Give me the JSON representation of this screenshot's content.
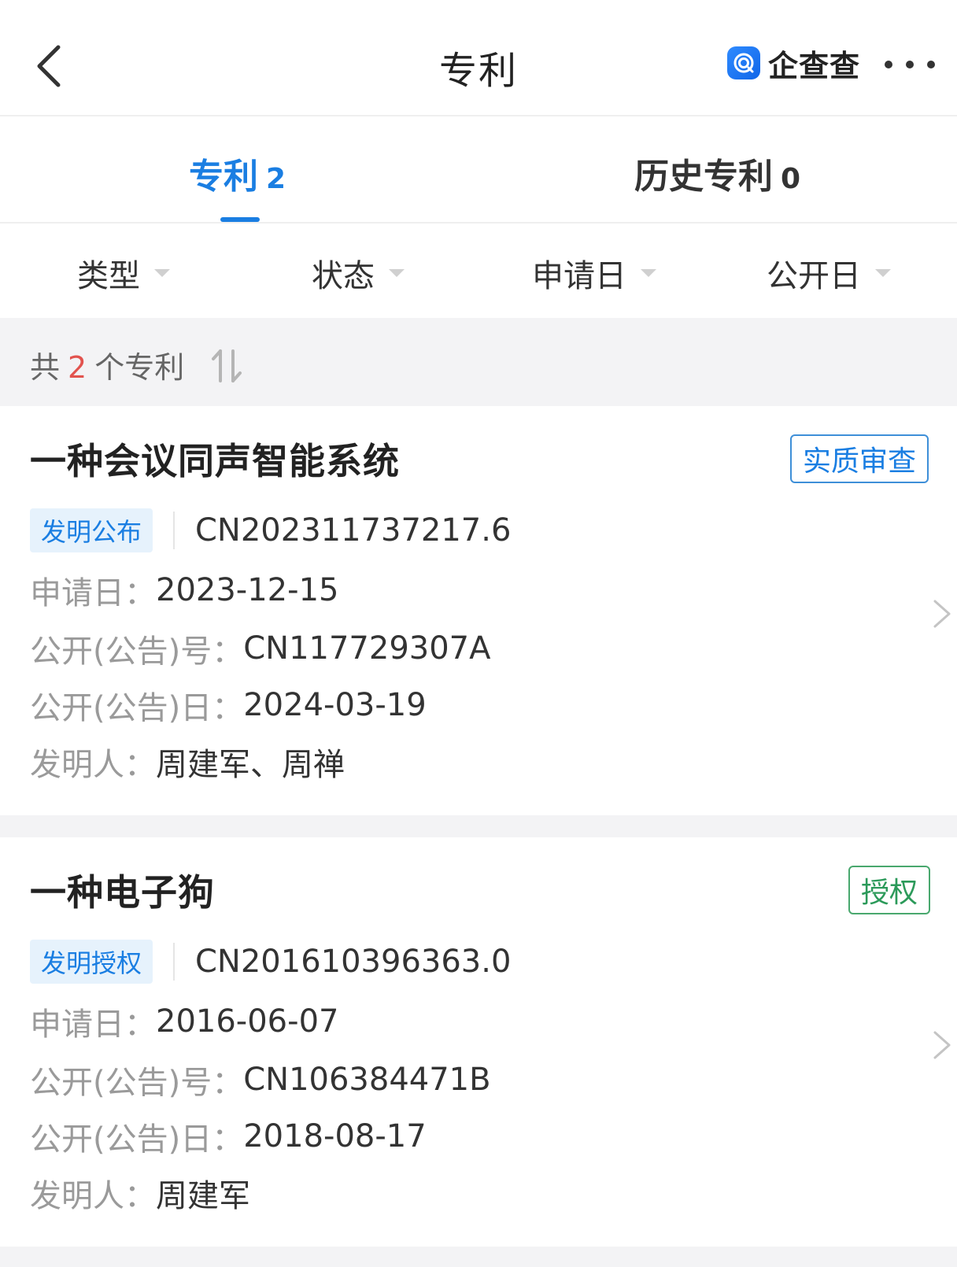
{
  "header": {
    "title": "专利",
    "brand_name": "企查查"
  },
  "tabs": [
    {
      "label": "专利",
      "count": "2",
      "active": true
    },
    {
      "label": "历史专利",
      "count": "0",
      "active": false
    }
  ],
  "filters": [
    "类型",
    "状态",
    "申请日",
    "公开日"
  ],
  "summary": {
    "prefix": "共",
    "count": "2",
    "suffix": "个专利"
  },
  "colors": {
    "accent": "#1a7ee2",
    "count_red": "#e2534e",
    "badge_green": "#2c9a5a",
    "page_bg": "#f3f3f5"
  },
  "patents": [
    {
      "title": "一种会议同声智能系统",
      "status": "实质审查",
      "status_color": "blue",
      "type_tag": "发明公布",
      "application_number": "CN202311737217.6",
      "application_date_label": "申请日：",
      "application_date": "2023-12-15",
      "publication_number_label": "公开(公告)号：",
      "publication_number": "CN117729307A",
      "publication_date_label": "公开(公告)日：",
      "publication_date": "2024-03-19",
      "inventor_label": "发明人：",
      "inventors": "周建军、周禅"
    },
    {
      "title": "一种电子狗",
      "status": "授权",
      "status_color": "green",
      "type_tag": "发明授权",
      "application_number": "CN201610396363.0",
      "application_date_label": "申请日：",
      "application_date": "2016-06-07",
      "publication_number_label": "公开(公告)号：",
      "publication_number": "CN106384471B",
      "publication_date_label": "公开(公告)日：",
      "publication_date": "2018-08-17",
      "inventor_label": "发明人：",
      "inventors": "周建军"
    }
  ]
}
